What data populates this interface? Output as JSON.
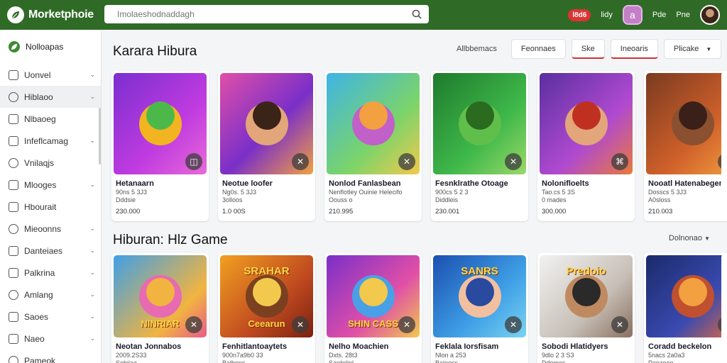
{
  "app": {
    "title": "Morketphoie"
  },
  "search": {
    "placeholder": "Imolaeshodnaddagh"
  },
  "header_right": {
    "pill": "l8d6",
    "link1": "lidy",
    "badge": "a",
    "link2": "Pde",
    "link3": "Pne"
  },
  "sidebar": {
    "header": "Nolloapas",
    "items": [
      {
        "label": "Uonvel",
        "chevron": true
      },
      {
        "label": "Hiblaoo",
        "chevron": true,
        "active": true
      },
      {
        "label": "Nlbaoeg",
        "chevron": false
      },
      {
        "label": "Infeflcamag",
        "chevron": true
      },
      {
        "label": "Vnilaqjs",
        "chevron": false
      },
      {
        "label": "Mlooges",
        "chevron": true
      },
      {
        "label": "Hbourait",
        "chevron": false
      },
      {
        "label": "Mieoonns",
        "chevron": true
      },
      {
        "label": "Danteiaes",
        "chevron": true
      },
      {
        "label": "Palkrina",
        "chevron": true
      },
      {
        "label": "Amlang",
        "chevron": true
      },
      {
        "label": "Saoes",
        "chevron": true
      },
      {
        "label": "Naeo",
        "chevron": true
      },
      {
        "label": "Pameok",
        "chevron": false
      }
    ]
  },
  "section1": {
    "title": "Karara Hibura",
    "filter_label": "Allbbemacs",
    "buttons": [
      "Feonnaes",
      "Ske",
      "Ineoaris",
      "Plicake"
    ],
    "cards": [
      {
        "title": "Hetanaarn",
        "sub1": "90ns 5 3J3",
        "sub2": "Dddsie",
        "price": "230.000",
        "action_icon": "image-icon"
      },
      {
        "title": "Neotue loofer",
        "sub1": "Ng0s. 5 3J3",
        "sub2": "3olloos",
        "price": "1.0 00S",
        "action_icon": "tools-icon"
      },
      {
        "title": "Nonlod Fanlasbean",
        "sub1": "Nenflotley Ouinie Helecifo",
        "sub2": "Oouss o",
        "price": "210.995",
        "action_icon": "tools-icon"
      },
      {
        "title": "Fesnklrathe Otoage",
        "sub1": "900cs 5 2 3",
        "sub2": "Diddleis",
        "price": "230.001",
        "action_icon": "tools-icon"
      },
      {
        "title": "Nolonifloelts",
        "sub1": "Tao.cs 5 3S",
        "sub2": "0 mades",
        "price": "300.000",
        "action_icon": "ml-icon"
      },
      {
        "title": "Nooatl Hatenabegenar",
        "sub1": "Dosscs 5 3J3",
        "sub2": "A0sloss",
        "price": "210.003",
        "action_icon": "tools-icon"
      }
    ]
  },
  "section2": {
    "title": "Hiburan: Hlz Game",
    "sort_label": "Dolnonao",
    "cards": [
      {
        "title": "Neotan Jonnabos",
        "sub1": "2009.2S33",
        "sub2": "Sobiiae",
        "banner_top": "",
        "banner_bottom": "NINRIAR"
      },
      {
        "title": "Fenhitlantoaytets",
        "sub1": "900n7a9b0 33",
        "sub2": "Balbons",
        "banner_top": "SRAHAR",
        "banner_bottom": "Ceearun"
      },
      {
        "title": "Nelho Moachien",
        "sub1": "Dxts. 28t3",
        "sub2": "Sardelinl",
        "banner_top": "",
        "banner_bottom": "SHIN CASS"
      },
      {
        "title": "Feklala Iorsfisam",
        "sub1": "Nlon a 253",
        "sub2": "Bainoss",
        "banner_top": "SANRS",
        "banner_bottom": ""
      },
      {
        "title": "Sobodi Hlatidyers",
        "sub1": "9dlo 2 3 S3",
        "sub2": "Ddomes",
        "banner_top": "Predoio",
        "banner_bottom": ""
      },
      {
        "title": "Coradd beckelon",
        "sub1": "5nacs 2a0a3",
        "sub2": "Panzoon",
        "banner_top": "",
        "banner_bottom": ""
      }
    ]
  },
  "colors": {
    "header": "#2f6b26",
    "accent": "#d33333"
  }
}
